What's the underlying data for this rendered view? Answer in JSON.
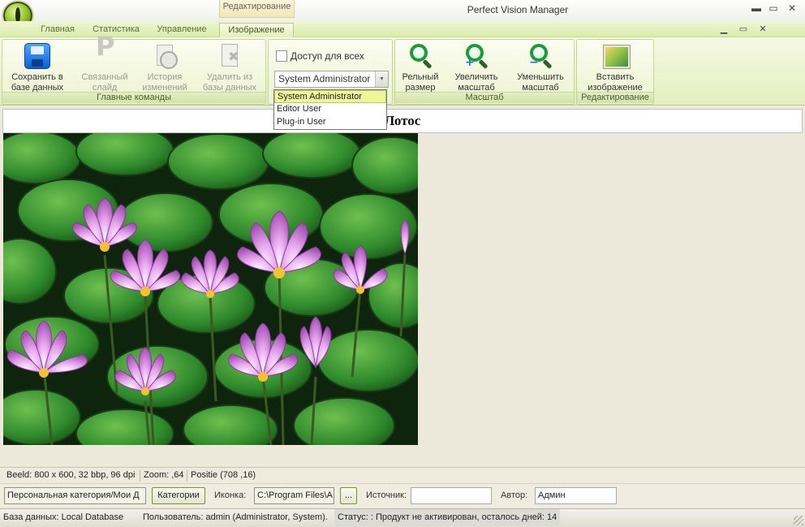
{
  "window": {
    "title": "Perfect Vision Manager",
    "context_tab_header": "Редактирование",
    "controls": {
      "minimize": "▬",
      "maximize": "▭",
      "close": "✕"
    }
  },
  "tabs": [
    {
      "label": "Главная",
      "active": false
    },
    {
      "label": "Статистика",
      "active": false
    },
    {
      "label": "Управление",
      "active": false
    },
    {
      "label": "Изображение",
      "active": true
    }
  ],
  "mdi_controls": {
    "minimize": "▁",
    "restore": "▭",
    "close": "✕"
  },
  "ribbon": {
    "main_group": {
      "label": "Главные команды",
      "buttons": [
        {
          "label": "Сохранить в базе данных",
          "icon": "save-icon",
          "enabled": true
        },
        {
          "label": "Связанный слайд",
          "icon": "linked-slide-icon",
          "enabled": false
        },
        {
          "label": "История изменений",
          "icon": "history-icon",
          "enabled": false
        },
        {
          "label": "Удалить из базы данных",
          "icon": "delete-icon",
          "enabled": false
        }
      ]
    },
    "access_group": {
      "checkbox_label": "Доступ для всех",
      "checked": false,
      "selected_user": "System Administrator",
      "user_options": [
        "System Administrator",
        "Editor User",
        "Plug-in User"
      ]
    },
    "zoom_group": {
      "label": "Масштаб",
      "buttons": [
        {
          "label": "Рельный размер",
          "icon": "actual-size-icon"
        },
        {
          "label": "Увеличить масштаб",
          "icon": "zoom-in-icon"
        },
        {
          "label": "Уменьшить масштаб",
          "icon": "zoom-out-icon"
        }
      ]
    },
    "edit_group": {
      "label": "Редактирование",
      "buttons": [
        {
          "label": "Вставить изображение",
          "icon": "insert-picture-icon"
        }
      ]
    }
  },
  "content": {
    "caption": "Лотос",
    "photo_subject": "water-lily-photo"
  },
  "image_info": {
    "format": "Beeld: 800 x 600, 32 bbp, 96 dpi",
    "zoom": "Zoom: ,64",
    "position": "Positie (708 ,16)"
  },
  "fields": {
    "category_value": "Персональная категория/Мои Д",
    "categories_button": "Категории",
    "icon_label": "Иконка:",
    "icon_path": "C:\\Program Files\\A",
    "browse_button": "...",
    "source_label": "Источник:",
    "source_value": "",
    "author_label": "Автор:",
    "author_value": "Админ"
  },
  "status": {
    "database": "База данных: Local Database",
    "user": "Пользователь: admin (Administrator, System).",
    "activation": "Статус: : Продукт не активирован, осталось дней: 14"
  }
}
